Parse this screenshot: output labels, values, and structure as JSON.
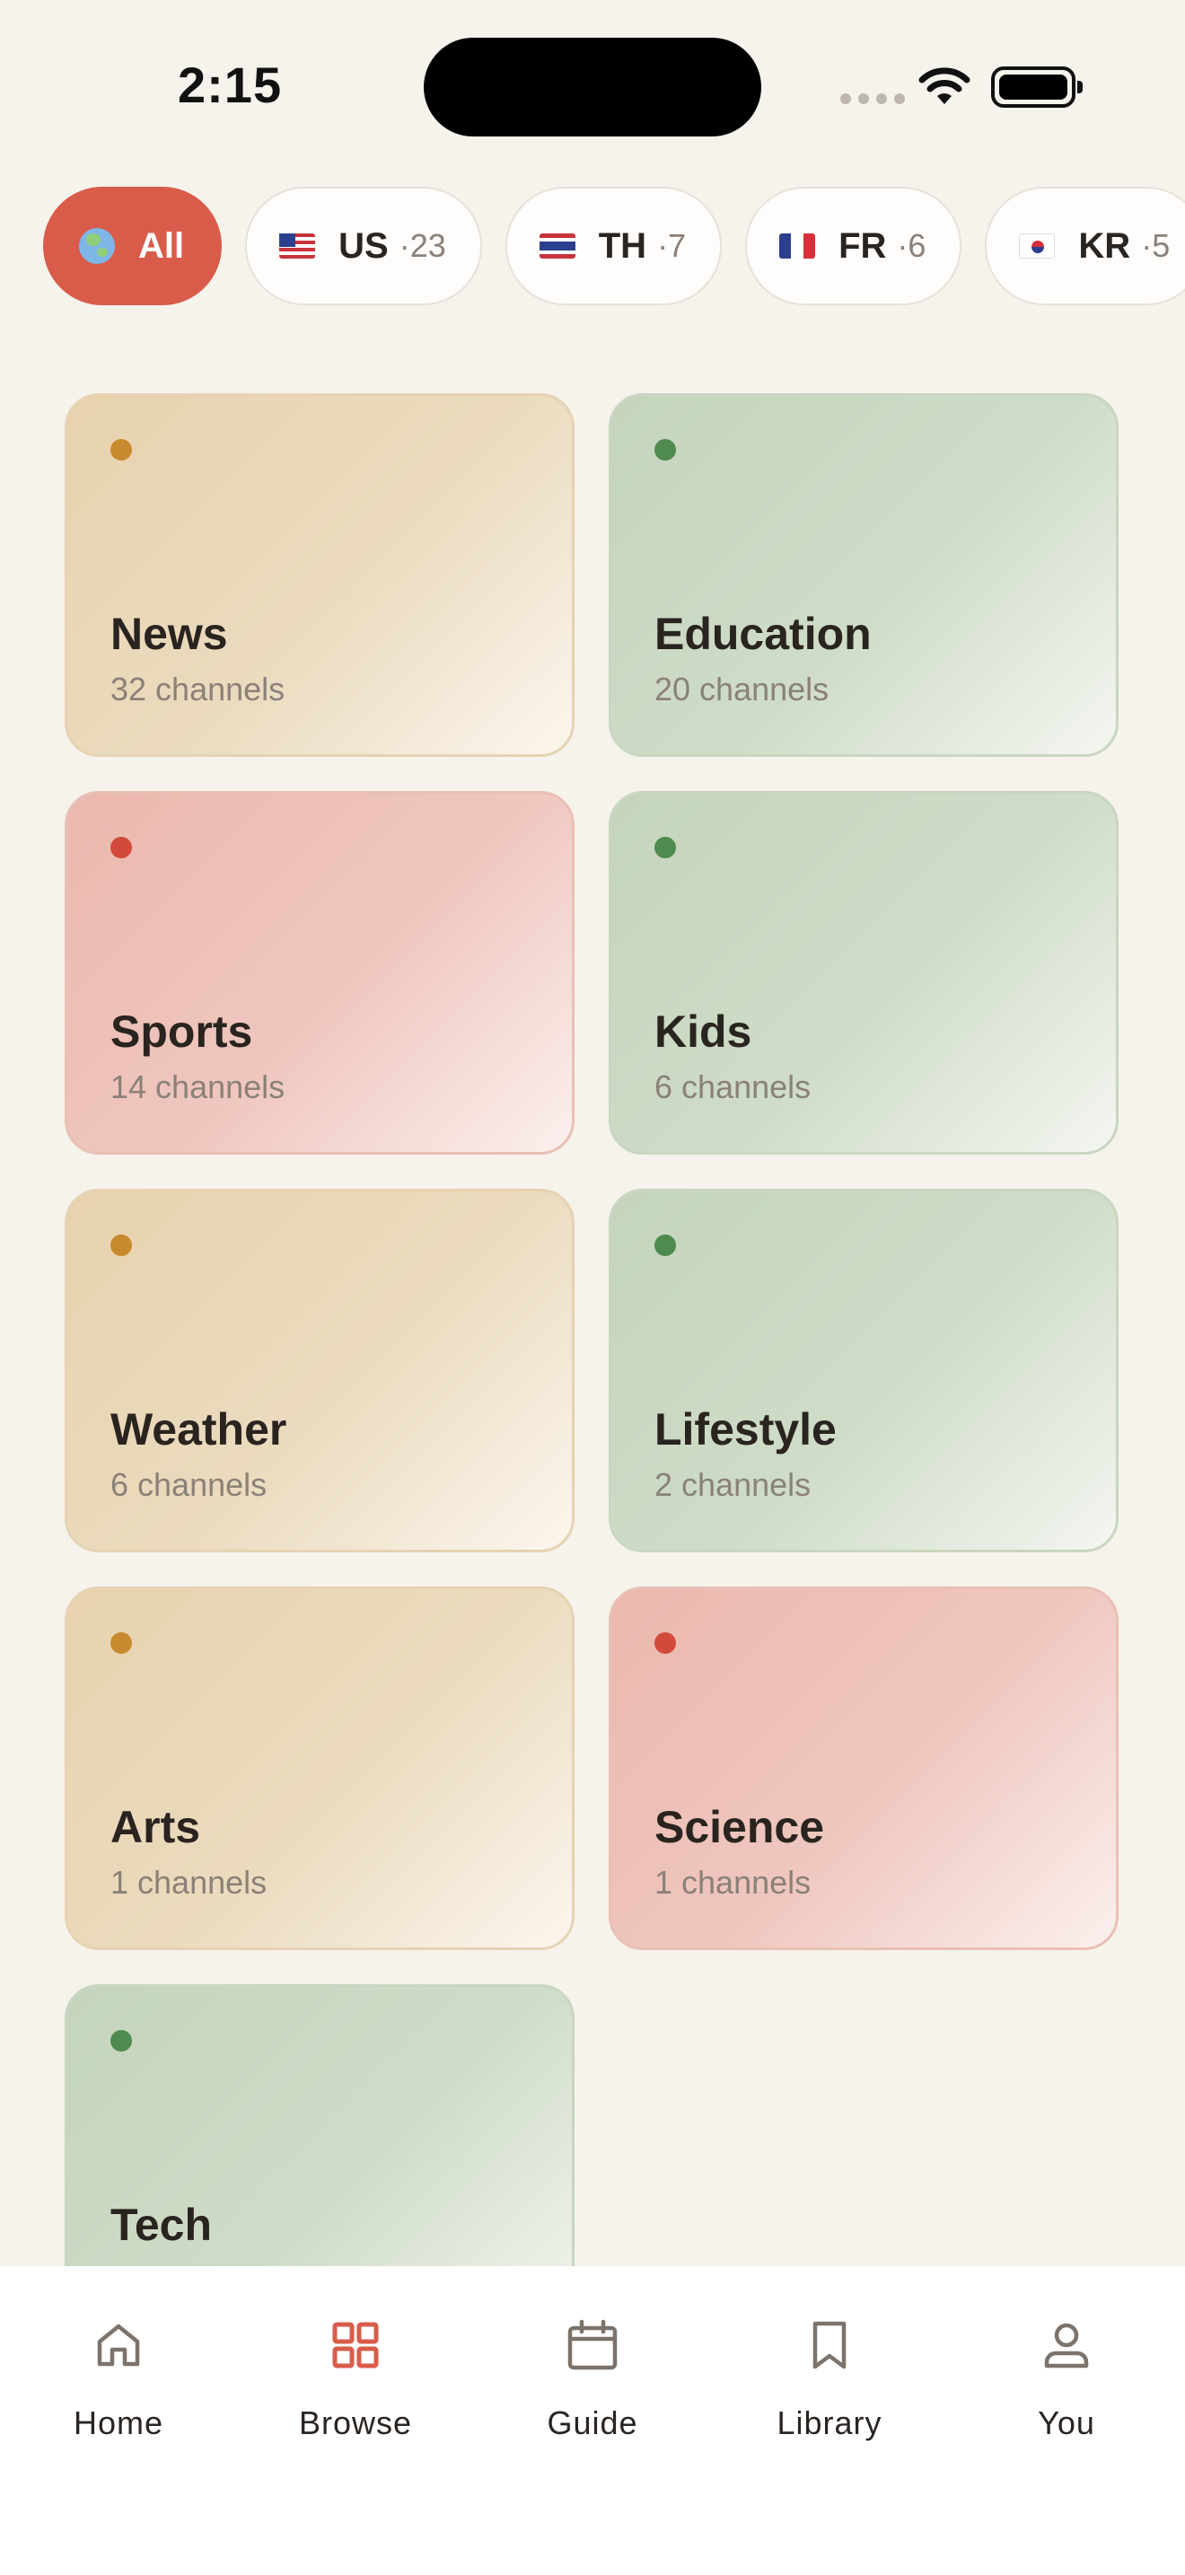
{
  "status_bar": {
    "time": "2:15"
  },
  "filters": [
    {
      "label": "All",
      "count": "",
      "flag": "globe-icon",
      "active": true
    },
    {
      "label": "US",
      "count": "·23",
      "flag": "us-flag-icon",
      "active": false
    },
    {
      "label": "TH",
      "count": "·7",
      "flag": "th-flag-icon",
      "active": false
    },
    {
      "label": "FR",
      "count": "·6",
      "flag": "fr-flag-icon",
      "active": false
    },
    {
      "label": "KR",
      "count": "·5",
      "flag": "kr-flag-icon",
      "active": false
    }
  ],
  "categories": [
    {
      "name": "News",
      "count": "32 channels",
      "tone": "amber"
    },
    {
      "name": "Education",
      "count": "20 channels",
      "tone": "green"
    },
    {
      "name": "Sports",
      "count": "14 channels",
      "tone": "red"
    },
    {
      "name": "Kids",
      "count": "6 channels",
      "tone": "green"
    },
    {
      "name": "Weather",
      "count": "6 channels",
      "tone": "amber"
    },
    {
      "name": "Lifestyle",
      "count": "2 channels",
      "tone": "green"
    },
    {
      "name": "Arts",
      "count": "1 channels",
      "tone": "amber"
    },
    {
      "name": "Science",
      "count": "1 channels",
      "tone": "red"
    },
    {
      "name": "Tech",
      "count": "",
      "tone": "green"
    }
  ],
  "tabs": [
    {
      "label": "Home",
      "icon": "home-icon",
      "active": false
    },
    {
      "label": "Browse",
      "icon": "grid-icon",
      "active": true
    },
    {
      "label": "Guide",
      "icon": "calendar-icon",
      "active": false
    },
    {
      "label": "Library",
      "icon": "bookmark-icon",
      "active": false
    },
    {
      "label": "You",
      "icon": "person-icon",
      "active": false
    }
  ],
  "colors": {
    "background": "#f6f2ec",
    "accent": "#d95c4a",
    "amber_dot": "#c88a2e",
    "green_dot": "#4f8a4e",
    "red_dot": "#d24a3c"
  }
}
